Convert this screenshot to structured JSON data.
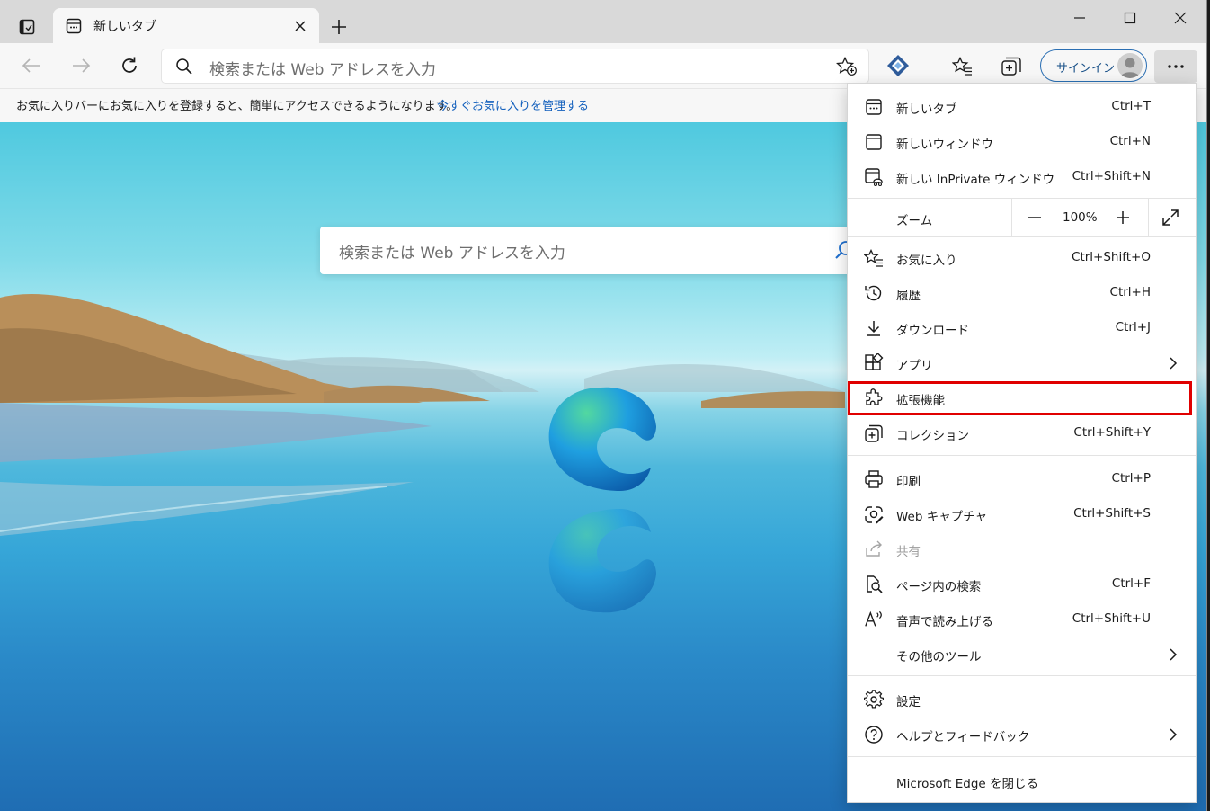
{
  "tab": {
    "title": "新しいタブ"
  },
  "address": {
    "placeholder": "検索または Web アドレスを入力"
  },
  "signin": {
    "label": "サインイン"
  },
  "favbar": {
    "message": "お気に入りバーにお気に入りを登録すると、簡単にアクセスできるようになります。",
    "link": "今すぐお気に入りを管理する"
  },
  "page_search": {
    "placeholder": "検索または Web アドレスを入力"
  },
  "menu": {
    "new_tab": {
      "label": "新しいタブ",
      "shortcut": "Ctrl+T"
    },
    "new_window": {
      "label": "新しいウィンドウ",
      "shortcut": "Ctrl+N"
    },
    "new_inprivate": {
      "label": "新しい InPrivate ウィンドウ",
      "shortcut": "Ctrl+Shift+N"
    },
    "zoom": {
      "label": "ズーム",
      "value": "100%"
    },
    "favorites": {
      "label": "お気に入り",
      "shortcut": "Ctrl+Shift+O"
    },
    "history": {
      "label": "履歴",
      "shortcut": "Ctrl+H"
    },
    "downloads": {
      "label": "ダウンロード",
      "shortcut": "Ctrl+J"
    },
    "apps": {
      "label": "アプリ"
    },
    "extensions": {
      "label": "拡張機能"
    },
    "collections": {
      "label": "コレクション",
      "shortcut": "Ctrl+Shift+Y"
    },
    "print": {
      "label": "印刷",
      "shortcut": "Ctrl+P"
    },
    "web_capture": {
      "label": "Web キャプチャ",
      "shortcut": "Ctrl+Shift+S"
    },
    "share": {
      "label": "共有"
    },
    "find": {
      "label": "ページ内の検索",
      "shortcut": "Ctrl+F"
    },
    "read_aloud": {
      "label": "音声で読み上げる",
      "shortcut": "Ctrl+Shift+U"
    },
    "more_tools": {
      "label": "その他のツール"
    },
    "settings": {
      "label": "設定"
    },
    "help": {
      "label": "ヘルプとフィードバック"
    },
    "close_edge": {
      "label": "Microsoft Edge を閉じる"
    }
  },
  "colors": {
    "highlight": "#e00000",
    "accent": "#1360bd"
  },
  "icons": [
    "tab-actions-icon",
    "new-tab-favicon",
    "close-icon",
    "plus-icon",
    "minimize-icon",
    "maximize-icon",
    "close-window-icon",
    "back-icon",
    "forward-icon",
    "refresh-icon",
    "search-icon",
    "add-favorite-icon",
    "extension-icon",
    "favorites-icon",
    "collections-icon",
    "avatar-icon",
    "more-icon"
  ]
}
